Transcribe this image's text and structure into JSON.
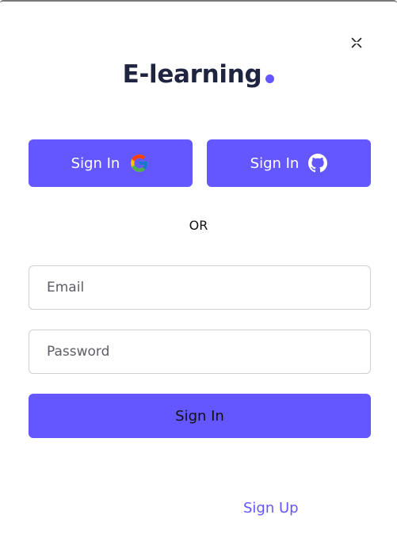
{
  "brand": {
    "name": "E-learning",
    "accent_color": "#6457ff"
  },
  "close": {
    "icon": "close-icon"
  },
  "social": {
    "google_label": "Sign In",
    "google_icon": "google-icon",
    "github_label": "Sign In",
    "github_icon": "github-icon"
  },
  "divider": {
    "text": "OR"
  },
  "form": {
    "email_placeholder": "Email",
    "password_placeholder": "Password",
    "submit_label": "Sign In"
  },
  "footer": {
    "signup_label": "Sign Up"
  }
}
